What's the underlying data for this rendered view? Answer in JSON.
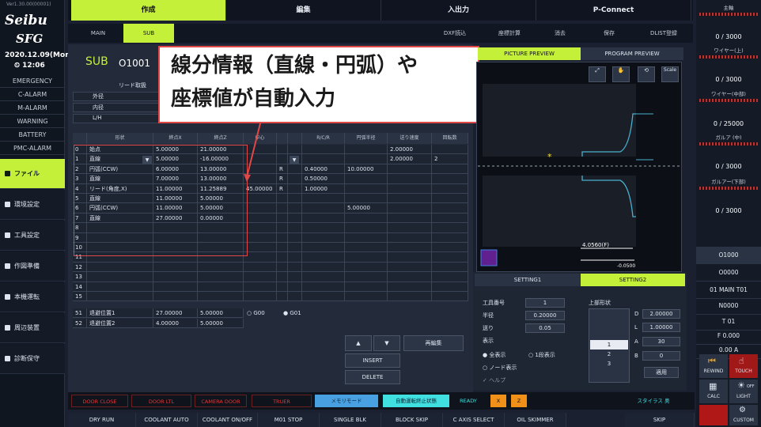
{
  "brand": {
    "logo_line1": "Seibu",
    "logo_line2": "SFG",
    "version": "Ver1.30.00(00001)"
  },
  "clock": {
    "date": "2020.12.09(Mon)",
    "time": "12:06"
  },
  "status_list": [
    "EMERGENCY",
    "C-ALARM",
    "M-ALARM",
    "WARNING",
    "BATTERY",
    "PMC-ALARM"
  ],
  "nav": [
    "ファイル",
    "環境設定",
    "工具設定",
    "作図準備",
    "本機運転",
    "周辺装置",
    "診断保守"
  ],
  "top_tabs": [
    "作成",
    "編集",
    "入出力",
    "P-Connect"
  ],
  "sub_tabs": {
    "main": "MAIN",
    "sub": "SUB",
    "r1": "DXF読込",
    "r2": "座標計算",
    "r3": "消去",
    "r4": "保存",
    "r5": "DLIST登録"
  },
  "program": {
    "type": "SUB",
    "number": "O1001"
  },
  "info": {
    "header": "リード取扱",
    "r1": "外径",
    "r2": "内径",
    "r3": "L/H"
  },
  "grid_head": [
    "",
    "形状",
    "終点X",
    "終点Z",
    "中心",
    "",
    "",
    "R/C/R",
    "円弧半径",
    "送り速度",
    "回転数"
  ],
  "rows": [
    [
      "0",
      "始点",
      "5.00000",
      "21.00000",
      "",
      "",
      "",
      "",
      "",
      "2.00000",
      ""
    ],
    [
      "1",
      "直線",
      "5.00000",
      "-16.00000",
      "",
      "",
      "",
      "",
      "",
      "2.00000",
      "2"
    ],
    [
      "2",
      "円弧(CCW)",
      "6.00000",
      "13.00000",
      "",
      "R",
      "",
      "0.40000",
      "10.00000",
      "",
      ""
    ],
    [
      "3",
      "直線",
      "7.00000",
      "13.00000",
      "",
      "R",
      "",
      "0.50000",
      "",
      "",
      ""
    ],
    [
      "4",
      "リード(角度,X)",
      "11.00000",
      "11.25889",
      "45.00000",
      "R",
      "",
      "1.00000",
      "",
      "",
      ""
    ],
    [
      "5",
      "直線",
      "11.00000",
      "5.00000",
      "",
      "",
      "",
      "",
      "",
      "",
      ""
    ],
    [
      "6",
      "円弧(CCW)",
      "11.00000",
      "5.00000",
      "",
      "",
      "",
      "",
      "5.00000",
      "",
      ""
    ],
    [
      "7",
      "直線",
      "27.00000",
      "0.00000",
      "",
      "",
      "",
      "",
      "",
      "",
      ""
    ],
    [
      "8",
      "",
      "",
      "",
      "",
      "",
      "",
      "",
      "",
      "",
      ""
    ],
    [
      "9",
      "",
      "",
      "",
      "",
      "",
      "",
      "",
      "",
      "",
      ""
    ],
    [
      "10",
      "",
      "",
      "",
      "",
      "",
      "",
      "",
      "",
      "",
      ""
    ],
    [
      "11",
      "",
      "",
      "",
      "",
      "",
      "",
      "",
      "",
      "",
      ""
    ],
    [
      "12",
      "",
      "",
      "",
      "",
      "",
      "",
      "",
      "",
      "",
      ""
    ],
    [
      "13",
      "",
      "",
      "",
      "",
      "",
      "",
      "",
      "",
      "",
      ""
    ],
    [
      "14",
      "",
      "",
      "",
      "",
      "",
      "",
      "",
      "",
      "",
      ""
    ],
    [
      "15",
      "",
      "",
      "",
      "",
      "",
      "",
      "",
      "",
      "",
      ""
    ]
  ],
  "extra_rows": [
    [
      "51",
      "退避位置1",
      "27.00000",
      "5.00000"
    ],
    [
      "52",
      "退避位置2",
      "4.00000",
      "5.00000"
    ]
  ],
  "radio": [
    "G00",
    "G01"
  ],
  "buttons": {
    "up": "▲",
    "down": "▼",
    "insert": "INSERT",
    "delete": "DELETE",
    "edit": "再編集"
  },
  "callout": {
    "line1": "線分情報（直線・円弧）や",
    "line2": "座標値が自動入力"
  },
  "preview": {
    "tab1": "PICTURE PREVIEW",
    "tab2": "PROGRAM PREVIEW",
    "scale": "Scale",
    "dim1": "4.0560(F)",
    "dim2": "-0.0500"
  },
  "settings": {
    "tab1": "SETTING1",
    "tab2": "SETTING2",
    "lbl1": "工具番号",
    "lbl2": "半径",
    "lbl3": "送り",
    "lbl4": "表示",
    "val1": "1",
    "val2": "0.20000",
    "val3": "0.05",
    "r1": "全表示",
    "r2": "1段表示",
    "r3": "ノード表示",
    "r4": "ヘルプ",
    "upper": "上部形状",
    "d": "D",
    "l": "L",
    "a": "A",
    "b": "B",
    "dv": "2.00000",
    "lv": "1.00000",
    "av": "30",
    "bv": "0",
    "list": [
      "1",
      "2",
      "3"
    ],
    "apply": "適用"
  },
  "right": {
    "g1": "主軸",
    "g1v": "0 / 3000",
    "g2": "ワイヤー(上)",
    "g2v": "0 / 3000",
    "g3": "ワイヤー(中部)",
    "g3v": "0 / 25000",
    "g4": "ガルア (中)",
    "g4v": "0 / 3000",
    "g5": "ガルアー(下部)",
    "g5v": "0 / 3000",
    "i1": "O1000",
    "i2": "O0000",
    "i3": "01 MAIN T01",
    "i4": "N0000",
    "i5": "T 01",
    "i6": "F 0.000",
    "i7": "0.00 A",
    "rewind": "REWIND",
    "touch": "TOUCH",
    "calc": "CALC",
    "light": "LIGHT",
    "custom": "CUSTOM",
    "off": "OFF"
  },
  "status_bar": {
    "a": "DOOR CLOSE",
    "b": "DOOR LTL",
    "c": "CAMERA DOOR",
    "d": "TRUER",
    "e": "メモリモード",
    "f": "自動運転終止状態",
    "ready": "READY",
    "x": "X",
    "z": "Z",
    "stylus": "スタイラス 奥"
  },
  "bottom": [
    "DRY RUN",
    "COOLANT AUTO",
    "COOLANT ON/OFF",
    "M01 STOP",
    "SINGLE BLK",
    "BLOCK SKIP",
    "C AXIS SELECT",
    "OIL SKIMMER",
    "SKIP"
  ]
}
